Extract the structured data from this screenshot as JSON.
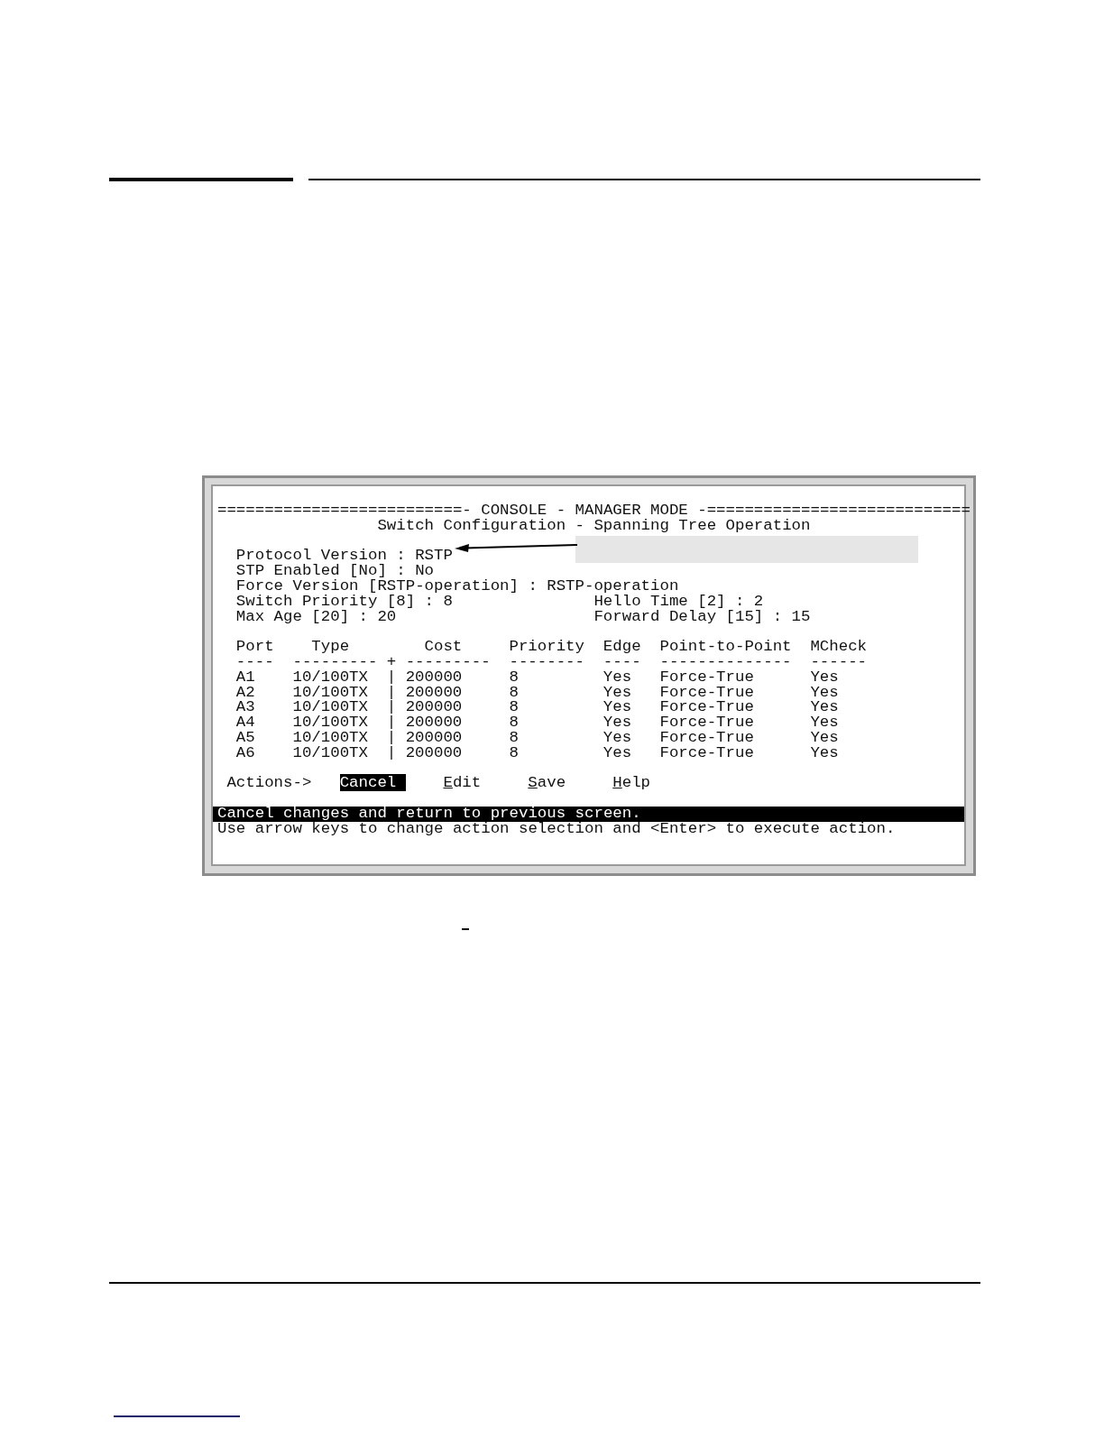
{
  "console": {
    "banner": "==========================- CONSOLE - MANAGER MODE -============================",
    "title": "Switch Configuration - Spanning Tree Operation",
    "settings": [
      {
        "left": "Protocol Version : RSTP"
      },
      {
        "left": "STP Enabled [No] : No"
      },
      {
        "left": "Force Version [RSTP-operation] : RSTP-operation"
      },
      {
        "left": "Switch Priority [8] : 8",
        "right": "Hello Time [2] : 2"
      },
      {
        "left": "Max Age [20] : 20",
        "right": "Forward Delay [15] : 15"
      }
    ],
    "table": {
      "columns": [
        "Port",
        "Type",
        "",
        "Cost",
        "Priority",
        "Edge",
        "Point-to-Point",
        "MCheck"
      ],
      "rule_row": [
        "----",
        "---------",
        "+",
        "---------",
        "--------",
        "----",
        "--------------",
        "------"
      ],
      "rows": [
        [
          "A1",
          "10/100TX",
          "|",
          "200000",
          "8",
          "Yes",
          "Force-True",
          "Yes"
        ],
        [
          "A2",
          "10/100TX",
          "|",
          "200000",
          "8",
          "Yes",
          "Force-True",
          "Yes"
        ],
        [
          "A3",
          "10/100TX",
          "|",
          "200000",
          "8",
          "Yes",
          "Force-True",
          "Yes"
        ],
        [
          "A4",
          "10/100TX",
          "|",
          "200000",
          "8",
          "Yes",
          "Force-True",
          "Yes"
        ],
        [
          "A5",
          "10/100TX",
          "|",
          "200000",
          "8",
          "Yes",
          "Force-True",
          "Yes"
        ],
        [
          "A6",
          "10/100TX",
          "|",
          "200000",
          "8",
          "Yes",
          "Force-True",
          "Yes"
        ]
      ]
    },
    "actions": {
      "label": "Actions->",
      "items": [
        {
          "label": "Cancel",
          "selected": true
        },
        {
          "label": "Edit",
          "selected": false
        },
        {
          "label": "Save",
          "selected": false
        },
        {
          "label": "Help",
          "selected": false
        }
      ]
    },
    "status": {
      "message": "Cancel changes and return to previous screen.",
      "highlighted": true
    },
    "help_line": "Use arrow keys to change action selection and <Enter> to execute action."
  }
}
